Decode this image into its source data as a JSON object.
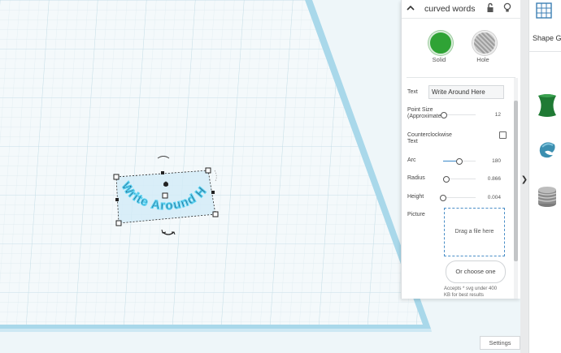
{
  "inspector": {
    "shape_name": "curved words",
    "solid_label": "Solid",
    "hole_label": "Hole",
    "props": {
      "text": {
        "label": "Text",
        "value": "Write Around Here"
      },
      "point_size": {
        "label_line1": "Point Size",
        "label_line2": "(Approximate",
        "value": "12",
        "level": 0.02
      },
      "ccw": {
        "label_line1": "Counterclockwise",
        "label_line2": "Text",
        "checked": false
      },
      "arc": {
        "label": "Arc",
        "value": "180",
        "level": 0.5
      },
      "radius": {
        "label": "Radius",
        "value": "0.866",
        "level": 0.1
      },
      "height": {
        "label": "Height",
        "value": "0.004",
        "level": 0.0
      },
      "picture": {
        "label": "Picture"
      }
    },
    "drop_zone_text": "Drag a file here",
    "choose_button": "Or choose one",
    "accepts_line1": "Accepts * svg under 400",
    "accepts_line2": "KB for best results"
  },
  "workplane": {
    "curved_text": "Write Around Here"
  },
  "shapes_panel": {
    "category_label": "Shape G",
    "items": [
      "extruded-shape",
      "torus-shape",
      "screw-thread-shape"
    ],
    "expand_arrow": "❯"
  },
  "footer": {
    "settings_label": "Settings"
  },
  "colors": {
    "grid_bg": "#eef6f9",
    "grid_minor": "#dbe9ee",
    "grid_major": "#b6d7e3",
    "workplane_edge": "#a9d8ea",
    "selection_fill": "#cfe9f6",
    "text_fill": "#2b6f92",
    "text_outline": "#59d2f2",
    "solid": "#2fa335",
    "slider_accent": "#3a89c9"
  }
}
